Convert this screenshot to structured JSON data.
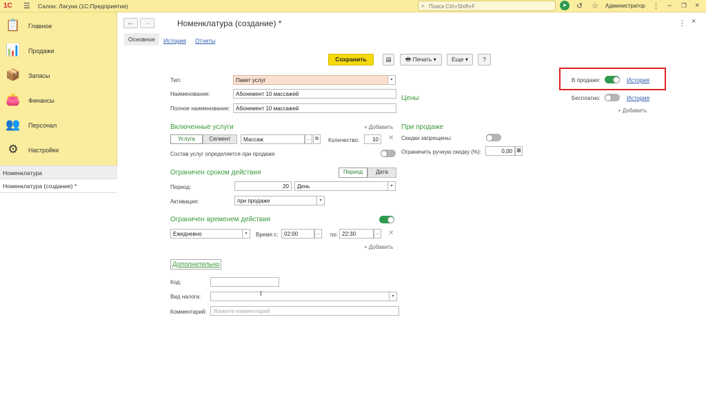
{
  "titlebar": {
    "logo": "1С",
    "app_title": "Салон: Лагуна  (1С:Предприятие)",
    "search_placeholder": "Поиск Ctrl+Shift+F",
    "user": "Администратор"
  },
  "sidebar": {
    "items": [
      {
        "label": "Главное",
        "icon": "clipboard-icon"
      },
      {
        "label": "Продажи",
        "icon": "chart-icon"
      },
      {
        "label": "Запасы",
        "icon": "box-icon"
      },
      {
        "label": "Финансы",
        "icon": "wallet-icon"
      },
      {
        "label": "Персонал",
        "icon": "people-icon"
      },
      {
        "label": "Настройки",
        "icon": "gear-icon"
      }
    ],
    "open_windows": [
      "Номенклатура",
      "Номенклатура (создание) *"
    ]
  },
  "form": {
    "title": "Номенклатура (создание) *",
    "tabs": [
      "Основное",
      "История",
      "Отчеты"
    ],
    "toolbar": {
      "save": "Сохранить",
      "print": "Печать",
      "more": "Еще",
      "help": "?"
    },
    "type_label": "Тип:",
    "type_value": "Пакет услуг",
    "name_label": "Наименование:",
    "name_value": "Абонемент 10 массажей",
    "fullname_label": "Полное наименование:",
    "fullname_value": "Абонемент 10 массажей",
    "included": {
      "title": "Включенные услуги",
      "add": "+ Добавить",
      "seg_service": "Услуга",
      "seg_segment": "Сегмент",
      "service_value": "Массаж",
      "qty_label": "Количество:",
      "qty_value": "10",
      "composition_label": "Состав услуг определяется при продаже"
    },
    "period_limit": {
      "title": "Ограничен сроком действия",
      "seg_period": "Период",
      "seg_date": "Дата",
      "period_label": "Период:",
      "period_value": "20",
      "period_unit": "День",
      "activation_label": "Активация:",
      "activation_value": "при продаже"
    },
    "time_limit": {
      "title": "Ограничен временем действия",
      "schedule": "Ежедневно",
      "from_label": "Время с:",
      "from_value": "02:00",
      "to_label": "по:",
      "to_value": "22:30",
      "add": "+ Добавить"
    },
    "additional": {
      "title": "Дополнительно",
      "code_label": "Код:",
      "code_value": "",
      "tax_label": "Вид налога:",
      "tax_value": "",
      "comment_label": "Комментарий:",
      "comment_placeholder": "Укажите комментарий"
    },
    "prices": {
      "title": "Цены",
      "on_sale_label": "В продаже:",
      "on_sale_history": "История",
      "free_label": "Бесплатно:",
      "free_history": "История",
      "add": "+ Добавить"
    },
    "on_sale_section": {
      "title": "При продаже",
      "discounts_forbidden_label": "Скидки запрещены:",
      "manual_discount_label": "Ограничить ручную скидку (%):",
      "manual_discount_value": "0,00"
    }
  },
  "colors": {
    "accent_yellow": "#fbed9e",
    "save_button": "#f5d90a",
    "section_green": "#3c9a3c",
    "toggle_on": "#2e9a4e",
    "highlight_red": "#e02020"
  }
}
